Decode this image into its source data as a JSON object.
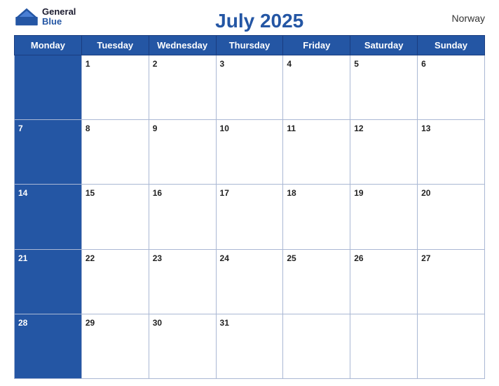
{
  "header": {
    "logo_general": "General",
    "logo_blue": "Blue",
    "title": "July 2025",
    "country": "Norway"
  },
  "weekdays": [
    "Monday",
    "Tuesday",
    "Wednesday",
    "Thursday",
    "Friday",
    "Saturday",
    "Sunday"
  ],
  "weeks": [
    [
      null,
      1,
      2,
      3,
      4,
      5,
      6
    ],
    [
      7,
      8,
      9,
      10,
      11,
      12,
      13
    ],
    [
      14,
      15,
      16,
      17,
      18,
      19,
      20
    ],
    [
      21,
      22,
      23,
      24,
      25,
      26,
      27
    ],
    [
      28,
      29,
      30,
      31,
      null,
      null,
      null
    ]
  ]
}
